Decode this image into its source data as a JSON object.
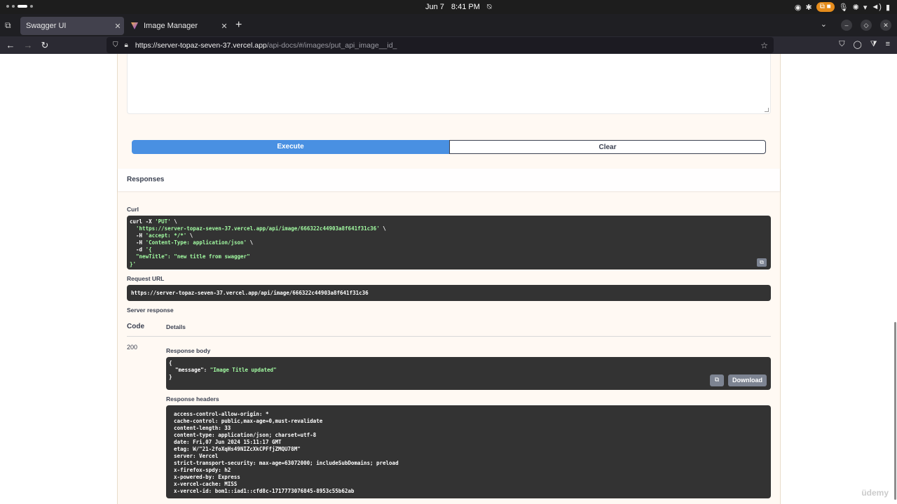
{
  "os": {
    "date": "Jun 7",
    "time": "8:41 PM",
    "tray_badge": "2"
  },
  "browser": {
    "tabs": [
      {
        "title": "Swagger UI",
        "active": true
      },
      {
        "title": "Image Manager",
        "active": false
      }
    ],
    "url_host": "https://server-topaz-seven-37.vercel.app",
    "url_path": "/api-docs/#/images/put_api_image__id_"
  },
  "swagger": {
    "execute_label": "Execute",
    "clear_label": "Clear",
    "responses_title": "Responses",
    "curl_label": "Curl",
    "curl": {
      "line1": "curl -X ",
      "method": "'PUT'",
      "line1_end": " \\",
      "url": "'https://server-topaz-seven-37.vercel.app/api/image/666322c44903a8f641f31c36'",
      "line2_end": " \\",
      "h_flag1": "-H ",
      "accept": "'accept: */*'",
      "line3_end": " \\",
      "h_flag2": "-H ",
      "content_type": "'Content-Type: application/json'",
      "line4_end": " \\",
      "d_flag": "-d ",
      "d_open": "'{",
      "body_key": "\"newTitle\": ",
      "body_val": "\"new title from swagger\"",
      "close": "}'"
    },
    "request_url_label": "Request URL",
    "request_url": "https://server-topaz-seven-37.vercel.app/api/image/666322c44903a8f641f31c36",
    "server_response_label": "Server response",
    "code_col": "Code",
    "details_col": "Details",
    "status_code": "200",
    "response_body_label": "Response body",
    "response_body": {
      "open": "{",
      "key": "  \"message\": ",
      "value": "\"Image Title updated\"",
      "close": "}"
    },
    "download_label": "Download",
    "response_headers_label": "Response headers",
    "response_headers": [
      "access-control-allow-origin: *",
      "cache-control: public,max-age=0,must-revalidate",
      "content-length: 33",
      "content-type: application/json; charset=utf-8",
      "date: Fri,07 Jun 2024 15:11:17 GMT",
      "etag: W/\"21-2foXqHs49NIZcXkCPFfjZMQU78M\"",
      "server: Vercel",
      "strict-transport-security: max-age=63072000; includeSubDomains; preload",
      "x-firefox-spdy: h2",
      "x-powered-by: Express",
      "x-vercel-cache: MISS",
      "x-vercel-id: bom1::iad1::cfd8c-1717773076845-8953c55b62ab"
    ]
  },
  "watermark": "üdemy"
}
